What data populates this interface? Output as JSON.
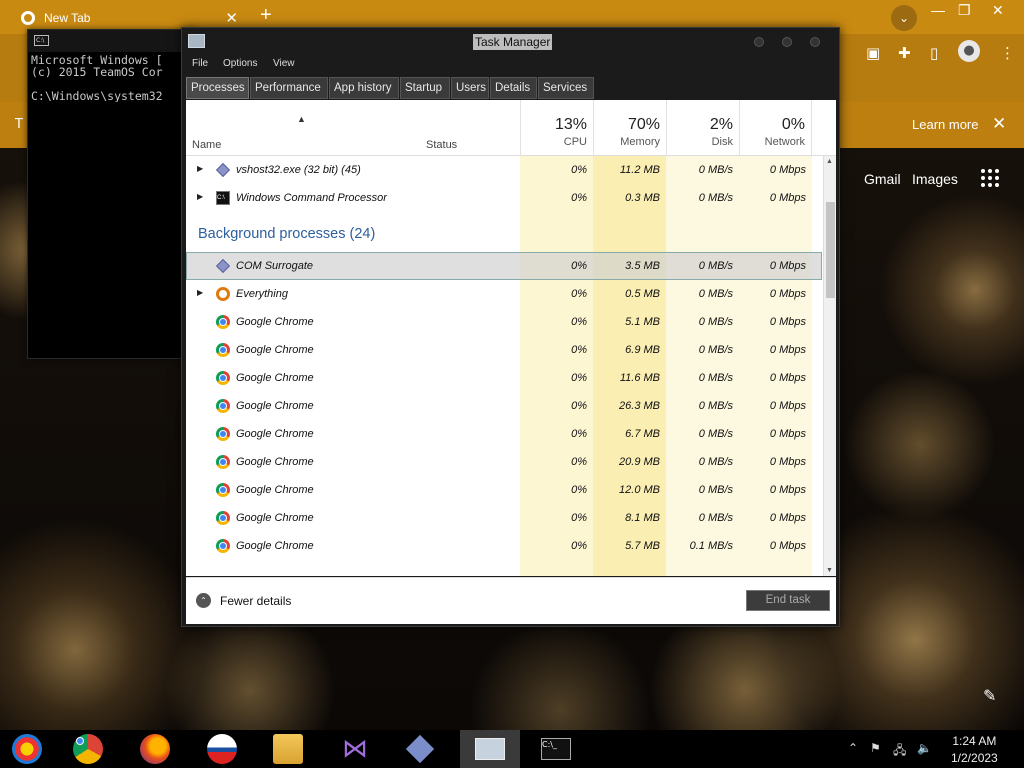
{
  "chrome": {
    "tab_title": "New Tab",
    "new_tab": "+",
    "close": "✕"
  },
  "infobar": {
    "learn_more": "Learn more",
    "left_letter": "T"
  },
  "google": {
    "gmail": "Gmail",
    "images": "Images"
  },
  "cmd": {
    "text": "Microsoft Windows [\n(c) 2015 TeamOS Cor\n\nC:\\Windows\\system32"
  },
  "taskmgr": {
    "title": "Task Manager",
    "menu": [
      "File",
      "Options",
      "View"
    ],
    "tabs": [
      "Processes",
      "Performance",
      "App history",
      "Startup",
      "Users",
      "Details",
      "Services"
    ],
    "headers": {
      "name": "Name",
      "status": "Status"
    },
    "columns": [
      {
        "pct": "13%",
        "label": "CPU"
      },
      {
        "pct": "70%",
        "label": "Memory"
      },
      {
        "pct": "2%",
        "label": "Disk"
      },
      {
        "pct": "0%",
        "label": "Network"
      }
    ],
    "apps": [
      {
        "name": "vshost32.exe (32 bit) (45)",
        "icon": "diamond-icon",
        "expand": true,
        "cpu": "0%",
        "mem": "11.2 MB",
        "disk": "0 MB/s",
        "net": "0 Mbps"
      },
      {
        "name": "Windows Command Processor",
        "icon": "cmd-icon",
        "expand": true,
        "cpu": "0%",
        "mem": "0.3 MB",
        "disk": "0 MB/s",
        "net": "0 Mbps"
      }
    ],
    "background_title": "Background processes (24)",
    "background": [
      {
        "name": "COM Surrogate",
        "icon": "diamond-icon",
        "expand": false,
        "selected": true,
        "cpu": "0%",
        "mem": "3.5 MB",
        "disk": "0 MB/s",
        "net": "0 Mbps"
      },
      {
        "name": "Everything",
        "icon": "everything-icon",
        "expand": true,
        "cpu": "0%",
        "mem": "0.5 MB",
        "disk": "0 MB/s",
        "net": "0 Mbps"
      },
      {
        "name": "Google Chrome",
        "icon": "chrome-icon",
        "expand": false,
        "cpu": "0%",
        "mem": "5.1 MB",
        "disk": "0 MB/s",
        "net": "0 Mbps"
      },
      {
        "name": "Google Chrome",
        "icon": "chrome-icon",
        "expand": false,
        "cpu": "0%",
        "mem": "6.9 MB",
        "disk": "0 MB/s",
        "net": "0 Mbps"
      },
      {
        "name": "Google Chrome",
        "icon": "chrome-icon",
        "expand": false,
        "cpu": "0%",
        "mem": "11.6 MB",
        "disk": "0 MB/s",
        "net": "0 Mbps"
      },
      {
        "name": "Google Chrome",
        "icon": "chrome-icon",
        "expand": false,
        "cpu": "0%",
        "mem": "26.3 MB",
        "disk": "0 MB/s",
        "net": "0 Mbps"
      },
      {
        "name": "Google Chrome",
        "icon": "chrome-icon",
        "expand": false,
        "cpu": "0%",
        "mem": "6.7 MB",
        "disk": "0 MB/s",
        "net": "0 Mbps"
      },
      {
        "name": "Google Chrome",
        "icon": "chrome-icon",
        "expand": false,
        "cpu": "0%",
        "mem": "20.9 MB",
        "disk": "0 MB/s",
        "net": "0 Mbps"
      },
      {
        "name": "Google Chrome",
        "icon": "chrome-icon",
        "expand": false,
        "cpu": "0%",
        "mem": "12.0 MB",
        "disk": "0 MB/s",
        "net": "0 Mbps"
      },
      {
        "name": "Google Chrome",
        "icon": "chrome-icon",
        "expand": false,
        "cpu": "0%",
        "mem": "8.1 MB",
        "disk": "0 MB/s",
        "net": "0 Mbps"
      },
      {
        "name": "Google Chrome",
        "icon": "chrome-icon",
        "expand": false,
        "cpu": "0%",
        "mem": "5.7 MB",
        "disk": "0.1 MB/s",
        "net": "0 Mbps"
      }
    ],
    "fewer_details": "Fewer details",
    "end_task": "End task",
    "colors": {
      "cpu_bg": "#fdf6d3",
      "mem_bg": "#fbeeb3",
      "accent": "#2c5f9e"
    }
  },
  "taskbar": {
    "time": "1:24 AM",
    "date": "1/2/2023",
    "apps": [
      "media-center-icon",
      "chrome-icon",
      "firefox-icon",
      "obama-logo-icon",
      "file-explorer-icon",
      "visual-studio-icon",
      "diamond-app-icon",
      "task-manager-icon",
      "cmd-icon"
    ]
  }
}
